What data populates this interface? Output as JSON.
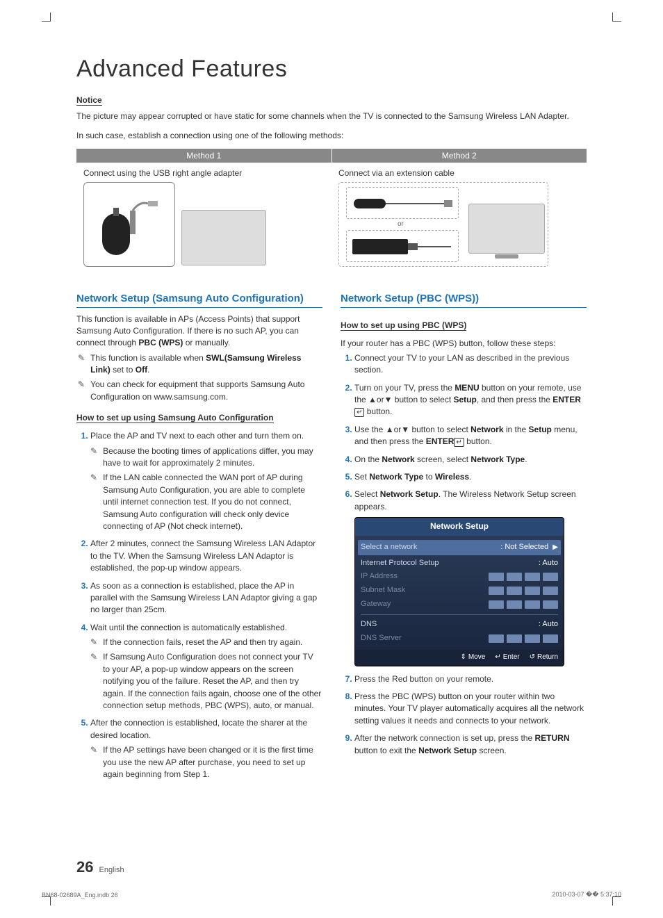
{
  "title": "Advanced Features",
  "notice": {
    "heading": "Notice",
    "p1": "The picture may appear corrupted or have static for some channels when the TV is connected to the Samsung Wireless LAN Adapter.",
    "p2": "In such case, establish a connection using one of the following methods:"
  },
  "methods": {
    "m1_label": "Method 1",
    "m2_label": "Method 2",
    "m1_text": "Connect using the USB right angle adapter",
    "m2_text": "Connect via an extension cable",
    "or": "or"
  },
  "left": {
    "section_title": "Network Setup (Samsung Auto Configuration)",
    "intro": "This function is available in APs (Access Points) that support Samsung Auto Configuration. If there is no such AP, you can connect through ",
    "intro_b1": "PBC (WPS)",
    "intro_tail": " or manually.",
    "note1_a": "This function is available when ",
    "note1_b": "SWL(Samsung Wireless Link)",
    "note1_c": " set to ",
    "note1_d": "Off",
    "note1_e": ".",
    "note2": "You can check for equipment that supports Samsung Auto Configuration on www.samsung.com.",
    "howto_h": "How to set up using Samsung Auto Configuration",
    "steps": {
      "s1": "Place the AP and TV next to each other and turn them on.",
      "s1n1": "Because the booting times of applications differ, you may have to wait for approximately 2 minutes.",
      "s1n2": "If the LAN cable connected the WAN port of AP during Samsung Auto Configuration, you are able to complete until internet connection test. If you do not connect, Samsung Auto configuration will check only device connecting of AP (Not check internet).",
      "s2": "After 2 minutes, connect the Samsung Wireless LAN Adaptor to the TV. When the Samsung Wireless LAN Adaptor is established, the pop-up window appears.",
      "s3": "As soon as a connection is established, place the AP in parallel with the Samsung Wireless LAN Adaptor giving a gap no larger than 25cm.",
      "s4": "Wait until the connection is automatically established.",
      "s4n1": "If the connection fails, reset the AP and then try again.",
      "s4n2": "If Samsung Auto Configuration does not connect your TV to your AP, a pop-up window appears on the screen notifying you of the failure. Reset the AP, and then try again. If the connection fails again, choose one of the other connection setup methods, PBC (WPS), auto, or manual.",
      "s5": "After the connection is established, locate the sharer at the desired location.",
      "s5n1": "If the AP settings have been changed or it is the first time you use the new AP after purchase, you need to set up again beginning from Step 1."
    }
  },
  "right": {
    "section_title": "Network Setup (PBC (WPS))",
    "howto_h": "How to set up using PBC (WPS)",
    "intro": "If your router has a PBC (WPS) button, follow these steps:",
    "steps": {
      "s1": "Connect your TV to your LAN as described in the previous section.",
      "s2a": "Turn on your TV, press the ",
      "s2b": "MENU",
      "s2c": " button on your remote, use the ▲or▼ button to select ",
      "s2d": "Setup",
      "s2e": ", and then press the ",
      "s2f": "ENTER",
      "s2g": " button.",
      "s3a": "Use the ▲or▼ button to select ",
      "s3b": "Network",
      "s3c": " in the ",
      "s3d": "Setup",
      "s3e": " menu, and then press the ",
      "s3f": "ENTER",
      "s3g": " button.",
      "s4a": "On the ",
      "s4b": "Network",
      "s4c": " screen, select ",
      "s4d": "Network Type",
      "s4e": ".",
      "s5a": "Set ",
      "s5b": "Network Type",
      "s5c": " to ",
      "s5d": "Wireless",
      "s5e": ".",
      "s6a": "Select ",
      "s6b": "Network Setup",
      "s6c": ". The Wireless Network Setup screen appears.",
      "s7": "Press the Red button on your remote.",
      "s8": "Press the PBC (WPS) button on your router within two minutes. Your TV player automatically acquires all the network setting values it needs and connects to your network.",
      "s9a": "After the network connection is set up, press the ",
      "s9b": "RETURN",
      "s9c": " button to exit the ",
      "s9d": "Network Setup",
      "s9e": " screen."
    }
  },
  "osd": {
    "title": "Network Setup",
    "rows": {
      "select_net": "Select a network",
      "select_net_val": ": Not Selected",
      "ip_setup": "Internet Protocol Setup",
      "ip_setup_val": ": Auto",
      "ip_addr": "IP Address",
      "subnet": "Subnet Mask",
      "gateway": "Gateway",
      "dns": "DNS",
      "dns_val": ": Auto",
      "dns_server": "DNS Server"
    },
    "footer": {
      "move": "Move",
      "enter": "Enter",
      "return": "Return"
    }
  },
  "page": {
    "num": "26",
    "lang": "English"
  },
  "print": {
    "left": "BN68-02689A_Eng.indb   26",
    "right": "2010-03-07   �� 5:37:10"
  }
}
